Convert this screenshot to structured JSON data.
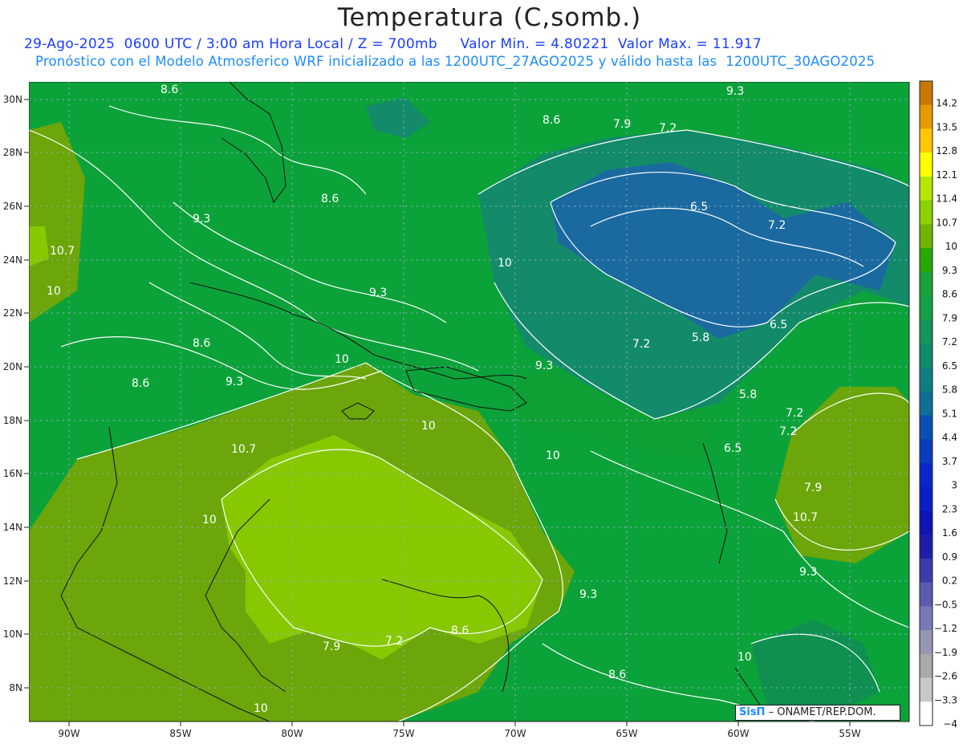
{
  "header": {
    "title": "Temperatura (C,somb.)",
    "date": "29-Ago-2025",
    "time_utc": "0600 UTC / 3:00 am Hora Local / Z = 700mb",
    "min_label": "Valor Min. = 4.80221",
    "max_label": "Valor Max. = 11.917",
    "forecast_note": "Pronóstico con el Modelo Atmosferico WRF inicializado a las 1200UTC_27AGO2025 y válido hasta las  1200UTC_30AGO2025"
  },
  "map": {
    "lon_labels": [
      "90W",
      "85W",
      "80W",
      "75W",
      "70W",
      "65W",
      "60W",
      "55W"
    ],
    "lat_labels": [
      "30N",
      "28N",
      "26N",
      "24N",
      "22N",
      "20N",
      "18N",
      "16N",
      "14N",
      "12N",
      "10N",
      "8N"
    ],
    "contour_labels": [
      "8.6",
      "9.3",
      "10",
      "10.7",
      "8.6",
      "9.3",
      "8.6",
      "8.6",
      "9.3",
      "10",
      "10.7",
      "10",
      "10",
      "9.3",
      "10",
      "9.3",
      "8.6",
      "7.9",
      "7.2",
      "6.5",
      "7.2",
      "6.5",
      "7.2",
      "5.8",
      "5.8",
      "7.2",
      "6.5",
      "7.2",
      "7.9",
      "9.3",
      "8.6",
      "10",
      "9.3",
      "7.9",
      "7.2",
      "8.6",
      "10",
      "10.7",
      "10"
    ],
    "colors": {
      "ocean_green": "#0ca23a",
      "mid_green": "#0fa232",
      "olive": "#6ca60a",
      "light_olive": "#87c800",
      "teal": "#138a6a",
      "blue": "#1a6aa0"
    }
  },
  "colorbar": {
    "labels": [
      "14.2",
      "13.5",
      "12.8",
      "12.1",
      "11.4",
      "10.7",
      "10",
      "9.3",
      "8.6",
      "7.9",
      "7.2",
      "6.5",
      "5.8",
      "5.1",
      "4.4",
      "3.7",
      "3",
      "2.3",
      "1.6",
      "0.9",
      "0.2",
      "−0.5",
      "−1.2",
      "−1.9",
      "−2.6",
      "−3.3",
      "−4"
    ],
    "colors": [
      "#c87800",
      "#e69a00",
      "#ffc800",
      "#ffff00",
      "#b4e600",
      "#8cd200",
      "#6eb400",
      "#2aa800",
      "#18a23a",
      "#14a046",
      "#12965a",
      "#0f8c6a",
      "#0f7e82",
      "#0f6e96",
      "#0a50b4",
      "#0a3cbe",
      "#0a28c8",
      "#0a1ec8",
      "#0f14b4",
      "#1e1eaa",
      "#3c3ca8",
      "#5a5aaf",
      "#7878b9",
      "#9696b4",
      "#aaaaaa",
      "#c8c8c8",
      "#ffffff"
    ]
  },
  "logo": {
    "brand": "SisΠ",
    "org": "– ONAMET/REP.DOM."
  }
}
